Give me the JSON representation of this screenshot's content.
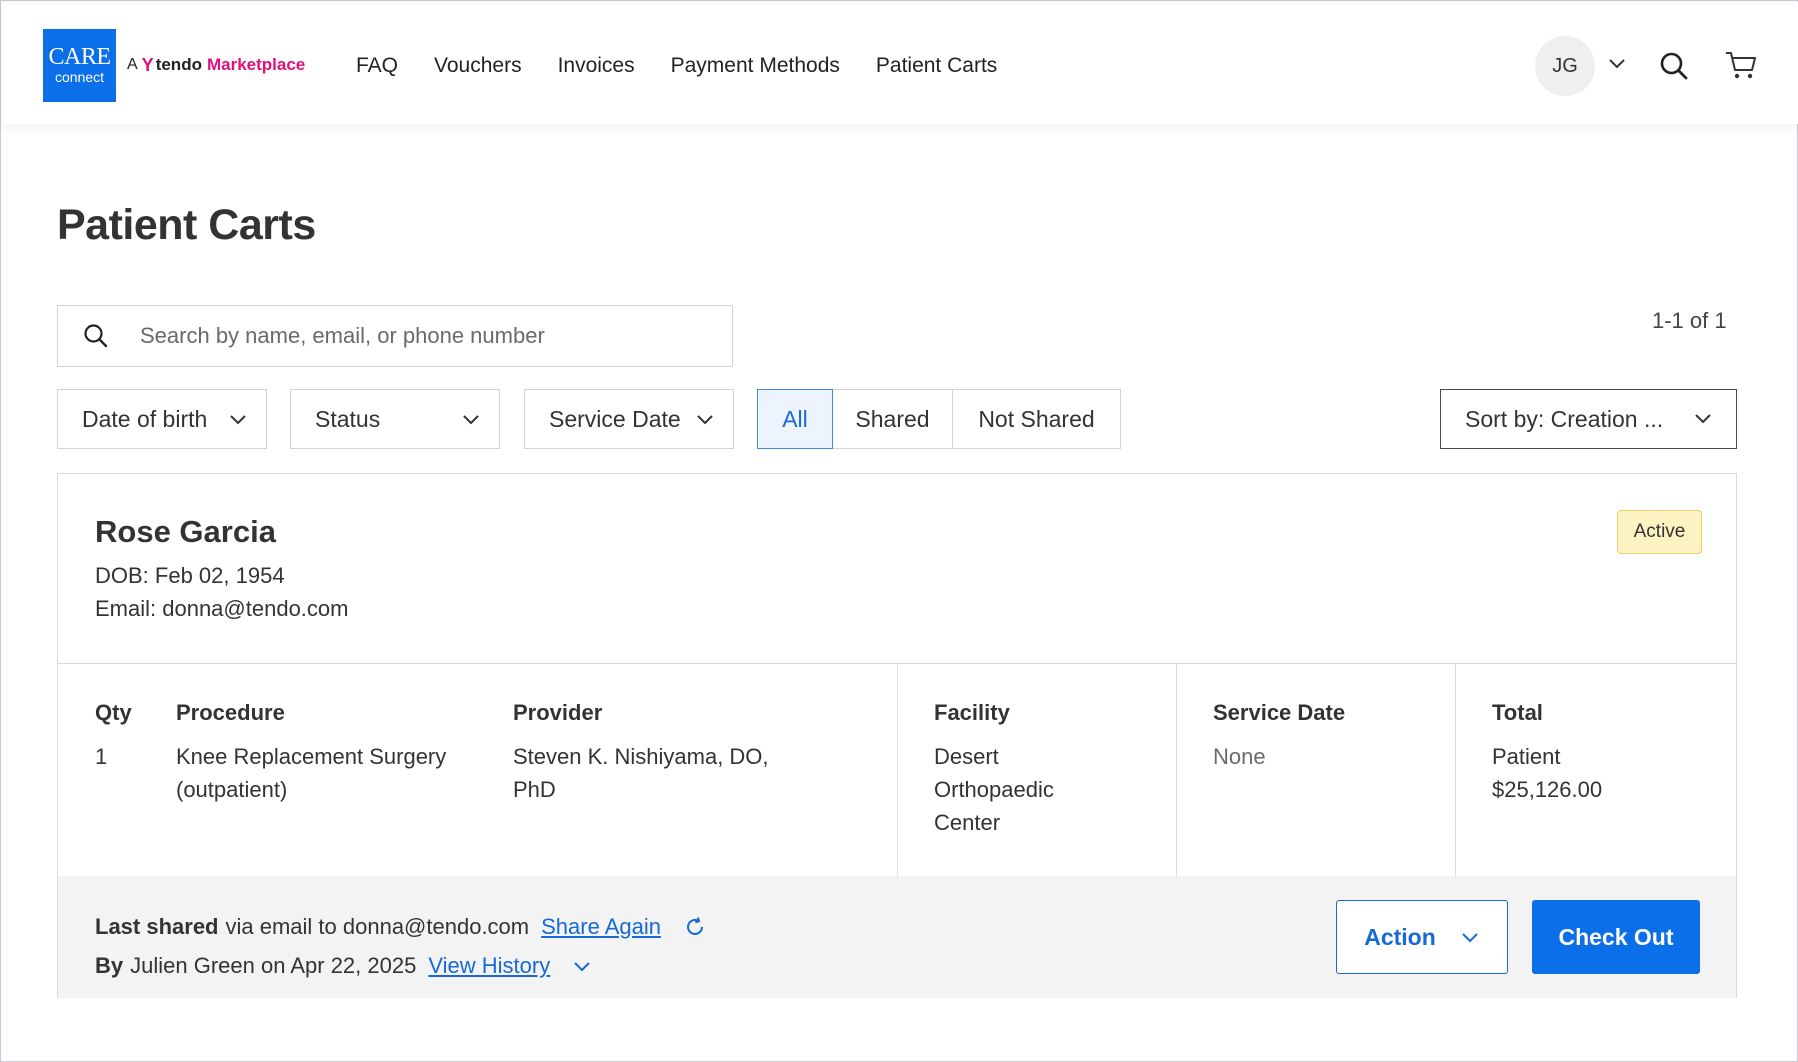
{
  "brand": {
    "logo_line1": "CARE",
    "logo_line2": "connect",
    "by": "A",
    "tendo": "tendo",
    "marketplace": "Marketplace",
    "accent": "#0a6fe8",
    "brand_pink": "#e0117d"
  },
  "nav": [
    {
      "label": "FAQ"
    },
    {
      "label": "Vouchers"
    },
    {
      "label": "Invoices"
    },
    {
      "label": "Payment Methods"
    },
    {
      "label": "Patient Carts"
    }
  ],
  "user": {
    "initials": "JG"
  },
  "page": {
    "title": "Patient Carts"
  },
  "search": {
    "placeholder": "Search by name, email, or phone number"
  },
  "results": {
    "count": "1-1 of 1"
  },
  "filters": {
    "dob": "Date of birth",
    "status": "Status",
    "service_date": "Service Date",
    "segments": [
      "All",
      "Shared",
      "Not Shared"
    ],
    "sort": "Sort by: Creation ..."
  },
  "cart": {
    "patient_name": "Rose Garcia",
    "dob": "DOB: Feb 02, 1954",
    "email": "Email: donna@tendo.com",
    "status": "Active",
    "columns": {
      "qty": "Qty",
      "procedure": "Procedure",
      "provider": "Provider",
      "facility": "Facility",
      "service_date": "Service Date",
      "total": "Total"
    },
    "item": {
      "qty": "1",
      "procedure_line1": "Knee Replacement Surgery",
      "procedure_line2": "(outpatient)",
      "provider_line1": "Steven K. Nishiyama, DO,",
      "provider_line2": "PhD",
      "facility_line1": "Desert",
      "facility_line2": "Orthopaedic",
      "facility_line3": "Center",
      "service_date": "None",
      "total_label": "Patient",
      "total_value": "$25,126.00"
    },
    "footer": {
      "last_shared": "Last shared",
      "via": "via email to donna@tendo.com",
      "share_again": "Share Again",
      "by": "By",
      "by_text": "Julien Green on Apr 22, 2025",
      "view_history": "View History",
      "action": "Action",
      "checkout": "Check Out"
    }
  }
}
